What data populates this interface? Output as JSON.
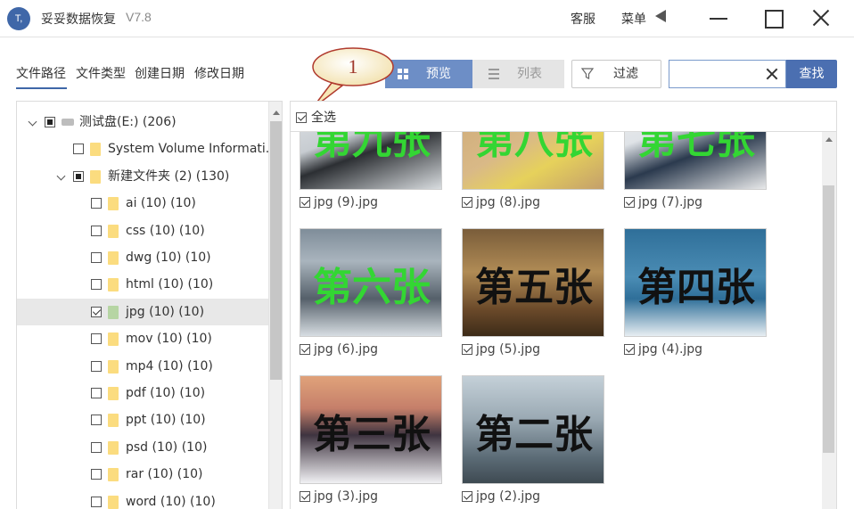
{
  "app": {
    "logo_text": "T,",
    "title": "妥妥数据恢复",
    "version": "V7.8",
    "service_label": "客服",
    "menu_label": "菜单"
  },
  "sort_tabs": [
    "文件路径",
    "文件类型",
    "创建日期",
    "修改日期"
  ],
  "callout": {
    "number": "1"
  },
  "toolbar": {
    "preview_label": "预览",
    "list_label": "列表",
    "filter_label": "过滤",
    "search_value": "",
    "search_button": "查找"
  },
  "tree": [
    {
      "label": "测试盘(E:)",
      "count": "(206)",
      "level": 0,
      "expanded": true,
      "check": "partial",
      "icon": "drive"
    },
    {
      "label": "System Volume Informati...",
      "count": "",
      "level": 1,
      "expanded": false,
      "check": "none",
      "icon": "folder"
    },
    {
      "label": "新建文件夹 (2)",
      "count": "(130)",
      "level": 1,
      "expanded": true,
      "check": "partial",
      "icon": "folder"
    },
    {
      "label": "ai (10)",
      "count": "(10)",
      "level": 2,
      "check": "none",
      "icon": "folder"
    },
    {
      "label": "css (10)",
      "count": "(10)",
      "level": 2,
      "check": "none",
      "icon": "folder"
    },
    {
      "label": "dwg (10)",
      "count": "(10)",
      "level": 2,
      "check": "none",
      "icon": "folder"
    },
    {
      "label": "html (10)",
      "count": "(10)",
      "level": 2,
      "check": "none",
      "icon": "folder"
    },
    {
      "label": "jpg (10)",
      "count": "(10)",
      "level": 2,
      "check": "checked",
      "icon": "folder-green",
      "selected": true
    },
    {
      "label": "mov (10)",
      "count": "(10)",
      "level": 2,
      "check": "none",
      "icon": "folder"
    },
    {
      "label": "mp4 (10)",
      "count": "(10)",
      "level": 2,
      "check": "none",
      "icon": "folder"
    },
    {
      "label": "pdf (10)",
      "count": "(10)",
      "level": 2,
      "check": "none",
      "icon": "folder"
    },
    {
      "label": "ppt (10)",
      "count": "(10)",
      "level": 2,
      "check": "none",
      "icon": "folder"
    },
    {
      "label": "psd (10)",
      "count": "(10)",
      "level": 2,
      "check": "none",
      "icon": "folder"
    },
    {
      "label": "rar (10)",
      "count": "(10)",
      "level": 2,
      "check": "none",
      "icon": "folder"
    },
    {
      "label": "word (10)",
      "count": "(10)",
      "level": 2,
      "check": "none",
      "icon": "folder"
    }
  ],
  "content": {
    "select_all_label": "全选",
    "items": [
      {
        "name": "jpg (9).jpg",
        "overlay": "第九张",
        "overlay_color": "#33d633",
        "bg": "desk"
      },
      {
        "name": "jpg (8).jpg",
        "overlay": "第八张",
        "overlay_color": "#33d633",
        "bg": "cork"
      },
      {
        "name": "jpg (7).jpg",
        "overlay": "第七张",
        "overlay_color": "#33d633",
        "bg": "laptop"
      },
      {
        "name": "jpg (6).jpg",
        "overlay": "第六张",
        "overlay_color": "#33d633",
        "bg": "pagoda"
      },
      {
        "name": "jpg (5).jpg",
        "overlay": "第五张",
        "overlay_color": "#111111",
        "bg": "field"
      },
      {
        "name": "jpg (4).jpg",
        "overlay": "第四张",
        "overlay_color": "#111111",
        "bg": "sea"
      },
      {
        "name": "jpg (3).jpg",
        "overlay": "第三张",
        "overlay_color": "#111111",
        "bg": "sunset"
      },
      {
        "name": "jpg (2).jpg",
        "overlay": "第二张",
        "overlay_color": "#111111",
        "bg": "forest"
      }
    ]
  },
  "colors": {
    "accent": "#3f67a8",
    "preview_active": "#6d8ec6",
    "search_button": "#4b6fb1",
    "selected_row": "#e8e8e8",
    "folder": "#fbdc7f"
  }
}
